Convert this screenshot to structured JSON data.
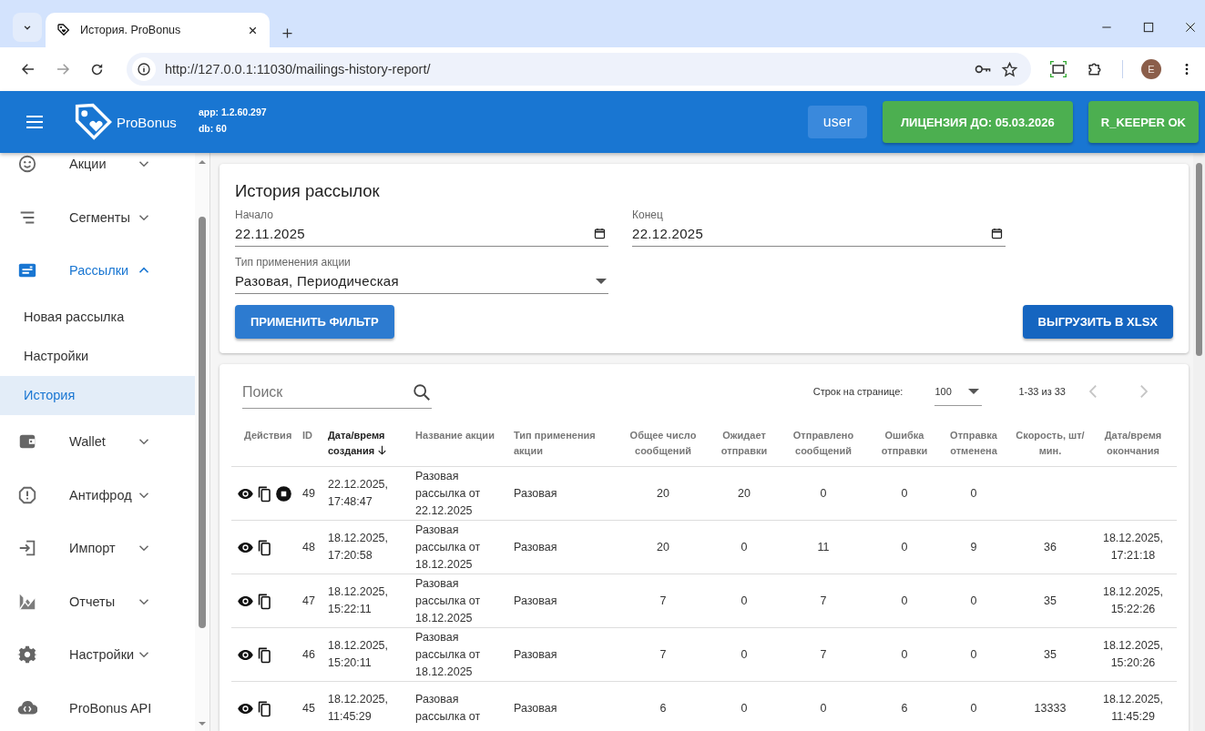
{
  "browser": {
    "tab_title": "История. ProBonus",
    "url": "http://127.0.0.1:11030/mailings-history-report/",
    "avatar": "E"
  },
  "header": {
    "brand": "ProBonus",
    "app_version": "app: 1.2.60.297",
    "db_version": "db: 60",
    "user": "user",
    "license": "ЛИЦЕНЗИЯ ДО: 05.03.2026",
    "rkeeper": "R_KEEPER OK"
  },
  "sidebar": {
    "items": [
      {
        "label": "Акции",
        "expanded": false
      },
      {
        "label": "Сегменты",
        "expanded": false
      },
      {
        "label": "Рассылки",
        "expanded": true,
        "children": [
          {
            "label": "Новая рассылка",
            "selected": false
          },
          {
            "label": "Настройки",
            "selected": false
          },
          {
            "label": "История",
            "selected": true
          }
        ]
      },
      {
        "label": "Wallet",
        "expanded": false
      },
      {
        "label": "Антифрод",
        "expanded": false
      },
      {
        "label": "Импорт",
        "expanded": false
      },
      {
        "label": "Отчеты",
        "expanded": false
      },
      {
        "label": "Настройки",
        "expanded": false
      },
      {
        "label": "ProBonus API"
      }
    ]
  },
  "filter": {
    "title": "История рассылок",
    "start": {
      "label": "Начало",
      "value": "22.11.2025"
    },
    "end": {
      "label": "Конец",
      "value": "22.12.2025"
    },
    "type": {
      "label": "Тип применения акции",
      "value": "Разовая, Периодическая"
    },
    "apply_button": "ПРИМЕНИТЬ ФИЛЬТР",
    "export_button": "ВЫГРУЗИТЬ В XLSX"
  },
  "table": {
    "search": {
      "placeholder": "Поиск"
    },
    "rows_per_page_label": "Строк на странице:",
    "rows_per_page": "100",
    "range": "1-33 из 33",
    "prev": {
      "disabled": true
    },
    "next": {
      "disabled": true
    },
    "columns": [
      {
        "label": "Действия",
        "sorted": false
      },
      {
        "label": "ID",
        "sorted": false
      },
      {
        "label": "Дата/время создания",
        "sorted": true
      },
      {
        "label": "Название акции",
        "sorted": false
      },
      {
        "label": "Тип применения акции",
        "sorted": false
      },
      {
        "label": "Общее число сообщений",
        "sorted": false
      },
      {
        "label": "Ожидает отправки",
        "sorted": false
      },
      {
        "label": "Отправлено сообщений",
        "sorted": false
      },
      {
        "label": "Ошибка отправки",
        "sorted": false
      },
      {
        "label": "Отправка отменена",
        "sorted": false
      },
      {
        "label": "Скорость, шт/мин.",
        "sorted": false
      },
      {
        "label": "Дата/время окончания",
        "sorted": false
      }
    ],
    "rows": [
      {
        "can_stop": true,
        "id": "49",
        "created": "22.12.2025, 17:48:47",
        "name": "Разовая рассылка от 22.12.2025",
        "type": "Разовая",
        "total": "20",
        "waiting": "20",
        "sent": "0",
        "errors": "0",
        "cancelled": "0"
      },
      {
        "can_stop": false,
        "id": "48",
        "created": "18.12.2025, 17:20:58",
        "name": "Разовая рассылка от 18.12.2025",
        "type": "Разовая",
        "total": "20",
        "waiting": "0",
        "sent": "11",
        "errors": "0",
        "cancelled": "9",
        "speed": "36",
        "ended": "18.12.2025, 17:21:18"
      },
      {
        "can_stop": false,
        "id": "47",
        "created": "18.12.2025, 15:22:11",
        "name": "Разовая рассылка от 18.12.2025",
        "type": "Разовая",
        "total": "7",
        "waiting": "0",
        "sent": "7",
        "errors": "0",
        "cancelled": "0",
        "speed": "35",
        "ended": "18.12.2025, 15:22:26"
      },
      {
        "can_stop": false,
        "id": "46",
        "created": "18.12.2025, 15:20:11",
        "name": "Разовая рассылка от 18.12.2025",
        "type": "Разовая",
        "total": "7",
        "waiting": "0",
        "sent": "7",
        "errors": "0",
        "cancelled": "0",
        "speed": "35",
        "ended": "18.12.2025, 15:20:26"
      },
      {
        "can_stop": false,
        "id": "45",
        "created": "18.12.2025, 11:45:29",
        "name": "Разовая рассылка от",
        "type": "Разовая",
        "total": "6",
        "waiting": "0",
        "sent": "0",
        "errors": "6",
        "cancelled": "0",
        "speed": "13333",
        "ended": "18.12.2025, 11:45:29"
      }
    ]
  }
}
